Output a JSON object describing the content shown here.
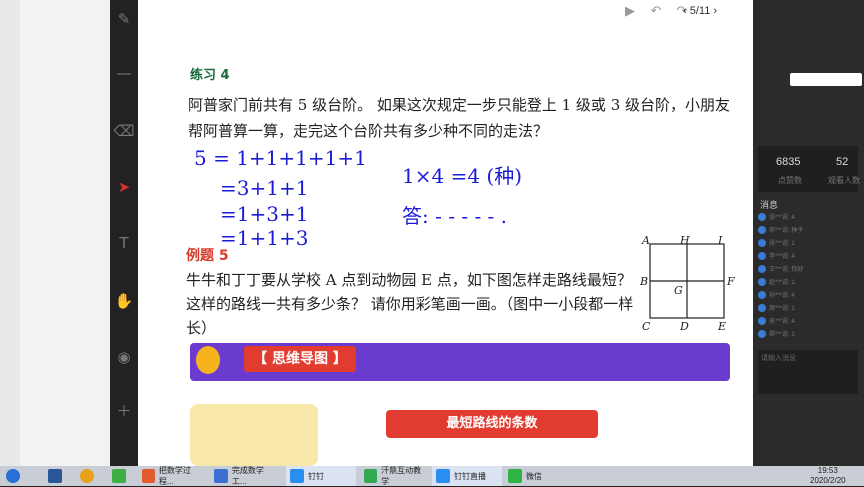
{
  "doc": {
    "page": "5/11",
    "exercise_title": "练习 4",
    "exercise_text": "阿普家门前共有 5 级台阶。 如果这次规定一步只能登上 1 级或 3 级台阶，小朋友帮阿普算一算，走完这个台阶共有多少种不同的走法？",
    "handwriting": [
      "5 = 1+1+1+1+1",
      "=3+1+1",
      "=1+3+1",
      "=1+1+3",
      "1×4 =4 (种)",
      "答: - - - - - ."
    ],
    "example_title": "例题 5",
    "example_text": "牛牛和丁丁要从学校 A 点到动物园 E 点，如下图怎样走路线最短？ 这样的路线一共有多少条？ 请你用彩笔画一画。（图中一小段都一样长）",
    "grid_labels": [
      "A",
      "H",
      "I",
      "B",
      "G",
      "F",
      "C",
      "D",
      "E"
    ],
    "mind_map_label": "【 思维导图 】",
    "shortest_label": "最短路线的条数"
  },
  "right_panel": {
    "stat1_value": "6835",
    "stat1_label": "点赞数",
    "stat2_value": "52",
    "stat2_label": "观看人数",
    "messages_title": "消息",
    "messages": [
      "张***说: 4",
      "邓***说: 种子",
      "张***说: 1",
      "李***说: 4",
      "王***说: 你好",
      "赵***说: 1",
      "孙***说: 4",
      "周***说: 1",
      "吴***说: 4",
      "郑***说: 1"
    ],
    "input_placeholder": "请输入消息"
  },
  "taskbar": {
    "items": [
      "把数学过程...",
      "完成数学工...",
      "钉钉",
      "汗鼎互动教学",
      "钉钉直播",
      "微信"
    ],
    "time": "19:53",
    "date": "2020/2/20"
  }
}
